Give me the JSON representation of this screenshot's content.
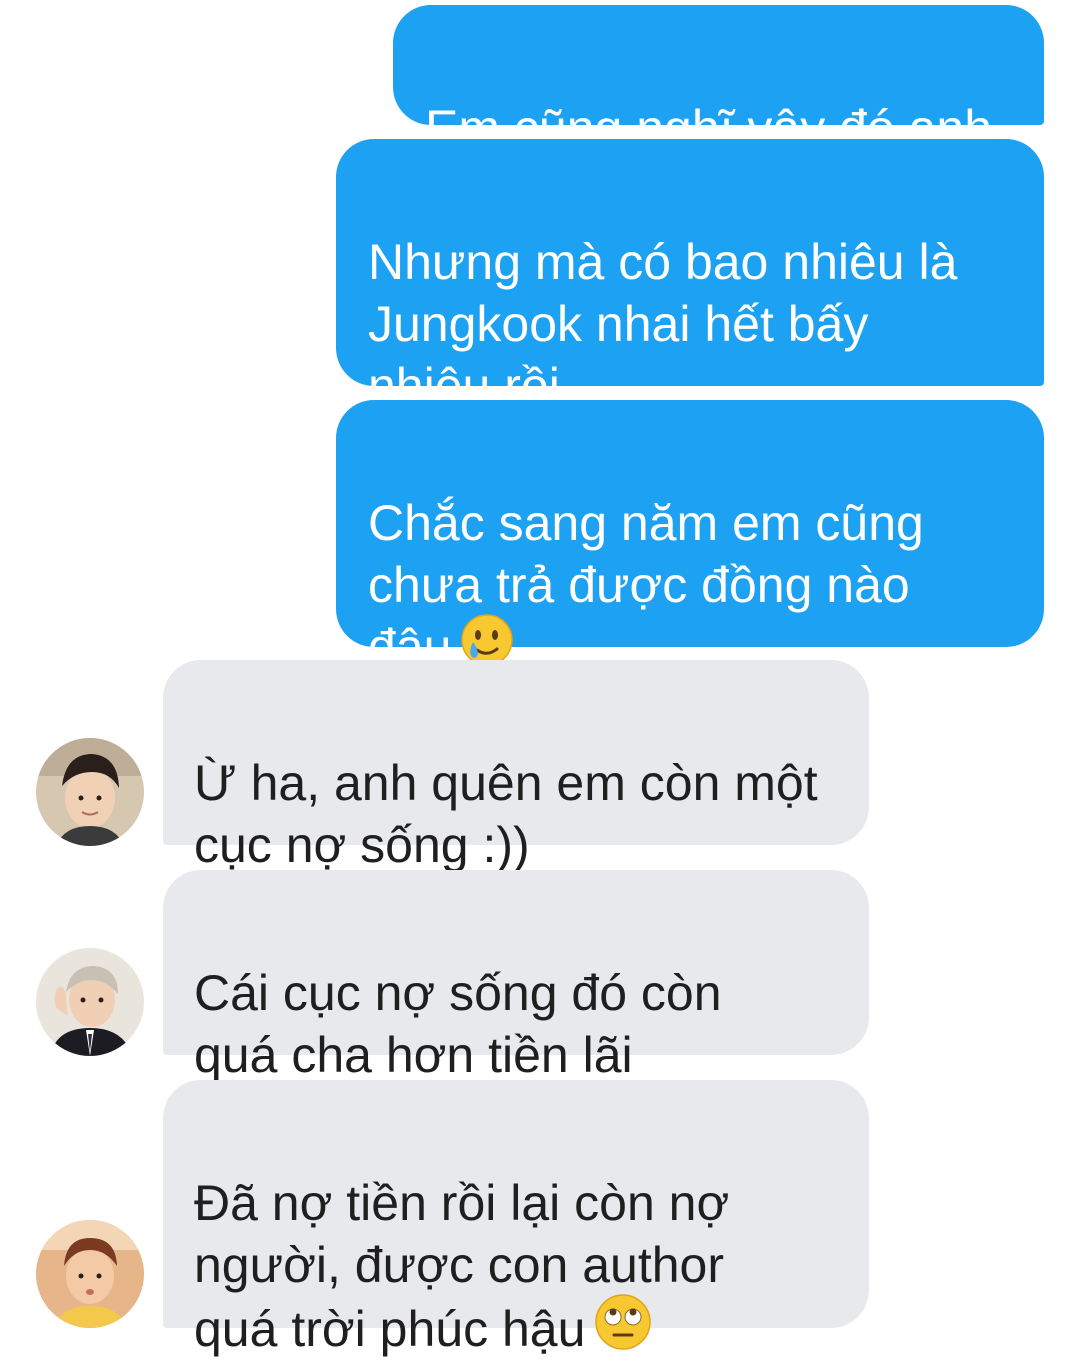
{
  "messages": [
    {
      "side": "outgoing",
      "text": "Em cũng nghĩ vậy đó anh"
    },
    {
      "side": "outgoing",
      "text": "Nhưng mà có bao nhiêu là\nJungkook nhai hết bấy\nnhiêu rồi"
    },
    {
      "side": "outgoing",
      "text": "Chắc sang năm em cũng\nchưa trả được đồng nào\nđâu",
      "emoji": "smiling-face-with-tear-emoji"
    },
    {
      "side": "incoming",
      "text": "Ừ ha, anh quên em còn một\ncục nợ sống :))",
      "avatar": "avatar-1"
    },
    {
      "side": "incoming",
      "text": "Cái cục nợ sống đó còn\nquá cha hơn tiền lãi",
      "avatar": "avatar-2"
    },
    {
      "side": "incoming",
      "text": "Đã nợ tiền rồi lại còn nợ\nngười, được con author\nquá trời phúc hậu",
      "emoji": "face-with-rolling-eyes-emoji",
      "avatar": "avatar-3"
    }
  ],
  "colors": {
    "outgoing_bubble": "#1da1f2",
    "outgoing_text": "#ffffff",
    "incoming_bubble": "#e7e9ec",
    "incoming_text": "#1f1f1f"
  }
}
